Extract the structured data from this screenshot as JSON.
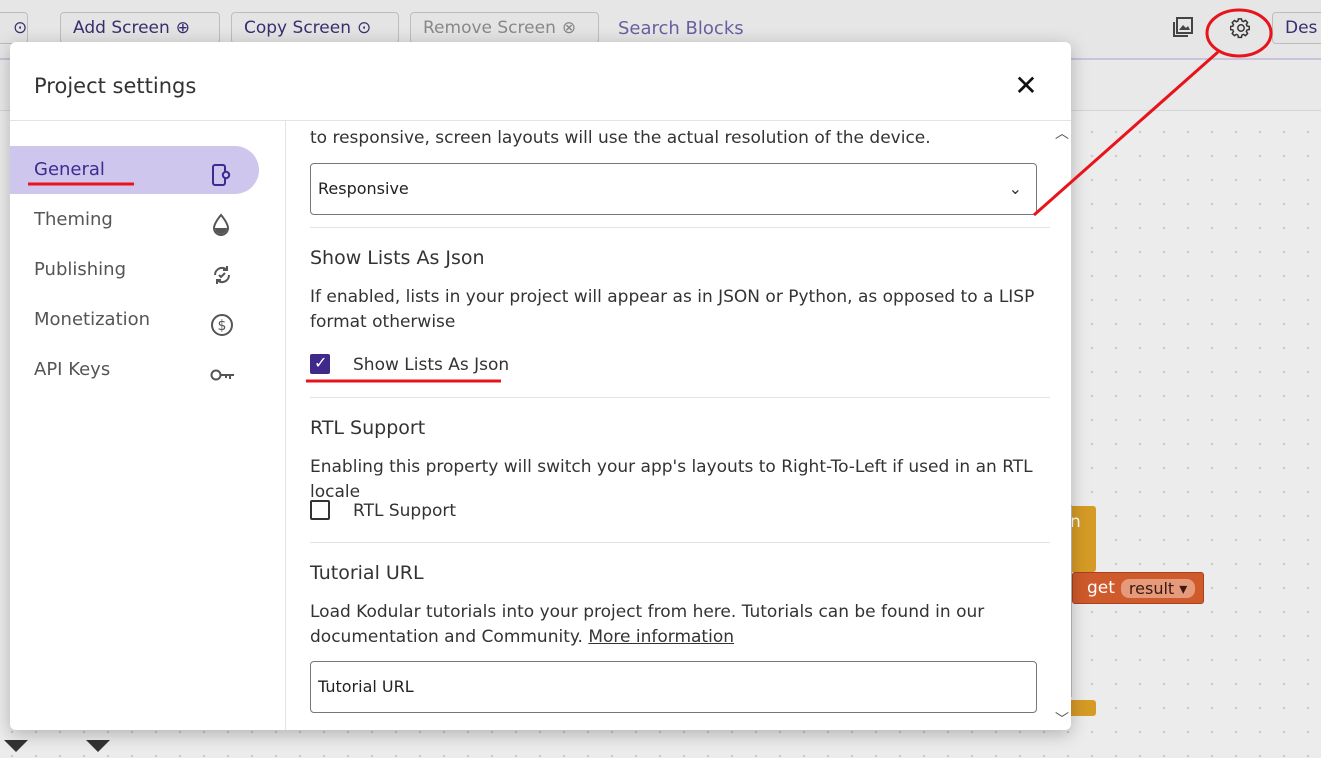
{
  "toolbar": {
    "add_screen": "Add Screen",
    "copy_screen": "Copy Screen",
    "remove_screen": "Remove Screen",
    "search_blocks": "Search Blocks",
    "designer_partial": "Des"
  },
  "blocks": {
    "get_label": "get",
    "variable": "result",
    "partial_text": "n"
  },
  "modal": {
    "title": "Project settings",
    "close_glyph": "✕"
  },
  "sidebar": {
    "items": [
      {
        "label": "General",
        "icon": "phone-settings-icon",
        "active": true
      },
      {
        "label": "Theming",
        "icon": "drop-icon",
        "active": false
      },
      {
        "label": "Publishing",
        "icon": "sync-icon",
        "active": false
      },
      {
        "label": "Monetization",
        "icon": "dollar-icon",
        "active": false
      },
      {
        "label": "API Keys",
        "icon": "key-icon",
        "active": false
      }
    ]
  },
  "content": {
    "sizing": {
      "description_partial": "to responsive, screen layouts will use the actual resolution of the device.",
      "selected": "Responsive"
    },
    "show_lists": {
      "title": "Show Lists As Json",
      "description": "If enabled, lists in your project will appear as in JSON or Python, as opposed to a LISP format otherwise",
      "checkbox_label": "Show Lists As Json",
      "checked": true
    },
    "rtl": {
      "title": "RTL Support",
      "description": "Enabling this property will switch your app's layouts to Right-To-Left if used in an RTL locale",
      "checkbox_label": "RTL Support",
      "checked": false
    },
    "tutorial": {
      "title": "Tutorial URL",
      "description": "Load Kodular tutorials into your project from here. Tutorials can be found in our documentation and Community.",
      "link": "More information",
      "placeholder": "Tutorial URL"
    }
  },
  "colors": {
    "accent": "#3f2a8c",
    "active_bg": "#cfc6ee",
    "annotation": "#e8141c"
  }
}
